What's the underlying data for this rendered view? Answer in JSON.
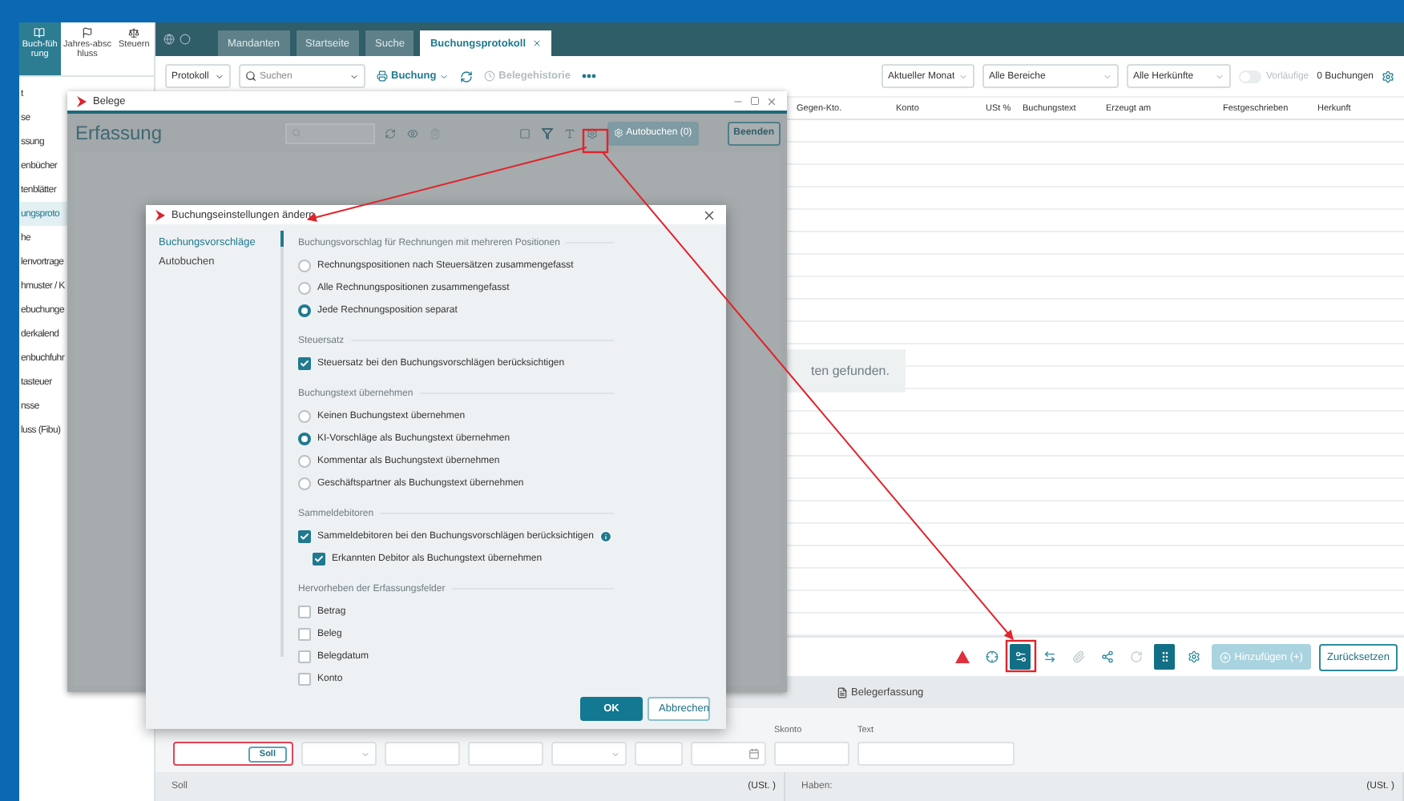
{
  "left_nav": {
    "top_items": [
      {
        "label": "Buch-führung",
        "selected": true
      },
      {
        "label": "Jahres-abschluss",
        "selected": false
      },
      {
        "label": "Steuern",
        "selected": false
      }
    ],
    "items": [
      {
        "label": "t",
        "selected": false
      },
      {
        "label": "se",
        "selected": false
      },
      {
        "label": "ssung",
        "selected": false
      },
      {
        "label": "enbücher",
        "selected": false
      },
      {
        "label": "tenblätter",
        "selected": false
      },
      {
        "label": "ungsproto",
        "selected": true
      },
      {
        "label": "he",
        "selected": false
      },
      {
        "label": "lenvortrage",
        "selected": false
      },
      {
        "label": "hmuster / K",
        "selected": false
      },
      {
        "label": "ebuchunge",
        "selected": false
      },
      {
        "label": "derkalend",
        "selected": false
      },
      {
        "label": "enbuchfuhr",
        "selected": false
      },
      {
        "label": "tasteuer",
        "selected": false
      },
      {
        "label": "nsse",
        "selected": false
      },
      {
        "label": "luss (Fibu)",
        "selected": false
      }
    ]
  },
  "tabs": [
    {
      "label": "Mandanten",
      "selected": false,
      "closable": false
    },
    {
      "label": "Startseite",
      "selected": false,
      "closable": false
    },
    {
      "label": "Suche",
      "selected": false,
      "closable": false
    },
    {
      "label": "Buchungsprotokoll",
      "selected": true,
      "closable": true
    }
  ],
  "toolbar": {
    "view": "Protokoll",
    "search_placeholder": "Suchen",
    "booking": "Buchung",
    "history": {
      "label": "Belegehistorie",
      "disabled": true
    },
    "filters": [
      "Aktueller Monat",
      "Alle Bereiche",
      "Alle Herkünfte"
    ],
    "toggle": {
      "label": "Vorläufige",
      "on": false,
      "disabled": true
    },
    "count": "0 Buchungen"
  },
  "table": {
    "columns": [
      "Gegen-Kto.",
      "Konto",
      "USt %",
      "Buchungstext",
      "Erzeugt am",
      "Festgeschrieben",
      "Herkunft"
    ],
    "empty_message": "ten gefunden."
  },
  "belege_window": {
    "title": "Belege",
    "heading": "Erfassung",
    "autobook": {
      "label": "Autobuchen (0)",
      "disabled": true
    },
    "close_button": "Beenden"
  },
  "dialog": {
    "title": "Buchungseinstellungen ändern",
    "nav": [
      {
        "label": "Buchungsvorschläge",
        "selected": true
      },
      {
        "label": "Autobuchen",
        "selected": false
      }
    ],
    "sections": [
      {
        "title": "Buchungsvorschlag für Rechnungen mit mehreren Positionen",
        "items": [
          {
            "kind": "radio",
            "label": "Rechnungspositionen nach Steuersätzen zusammengefasst",
            "selected": false
          },
          {
            "kind": "radio",
            "label": "Alle Rechnungspositionen zusammengefasst",
            "selected": false
          },
          {
            "kind": "radio",
            "label": "Jede Rechnungsposition separat",
            "selected": true
          }
        ]
      },
      {
        "title": "Steuersatz",
        "items": [
          {
            "kind": "checkbox",
            "label": "Steuersatz bei den Buchungsvorschlägen berücksichtigen",
            "checked": true
          }
        ]
      },
      {
        "title": "Buchungstext übernehmen",
        "items": [
          {
            "kind": "radio",
            "label": "Keinen Buchungstext übernehmen",
            "selected": false
          },
          {
            "kind": "radio",
            "label": "KI-Vorschläge als Buchungstext übernehmen",
            "selected": true
          },
          {
            "kind": "radio",
            "label": "Kommentar als Buchungstext übernehmen",
            "selected": false
          },
          {
            "kind": "radio",
            "label": "Geschäftspartner als Buchungstext übernehmen",
            "selected": false
          }
        ]
      },
      {
        "title": "Sammeldebitoren",
        "items": [
          {
            "kind": "checkbox",
            "label": "Sammeldebitoren bei den Buchungsvorschlägen berücksichtigen",
            "checked": true,
            "info": true,
            "children": [
              {
                "kind": "checkbox",
                "label": "Erkannten Debitor als Buchungstext übernehmen",
                "checked": true
              }
            ]
          }
        ]
      },
      {
        "title": "Hervorheben der Erfassungsfelder",
        "items": [
          {
            "kind": "checkbox",
            "label": "Betrag",
            "checked": false
          },
          {
            "kind": "checkbox",
            "label": "Beleg",
            "checked": false
          },
          {
            "kind": "checkbox",
            "label": "Belegdatum",
            "checked": false
          },
          {
            "kind": "checkbox",
            "label": "Konto",
            "checked": false
          }
        ]
      }
    ],
    "ok": "OK",
    "cancel": "Abbrechen"
  },
  "bottom_toolbar": {
    "icons": [
      {
        "kind": "warning",
        "selected": false
      },
      {
        "kind": "target",
        "selected": false
      },
      {
        "kind": "settings",
        "selected": true
      },
      {
        "kind": "swap",
        "selected": false
      },
      {
        "kind": "attach",
        "selected": false
      },
      {
        "kind": "share",
        "selected": false
      },
      {
        "kind": "reload",
        "selected": false
      },
      {
        "kind": "grip",
        "selected": true
      },
      {
        "kind": "gear",
        "selected": false
      }
    ],
    "add": {
      "label": "Hinzufügen (+)",
      "disabled": true
    },
    "reset": "Zurücksetzen"
  },
  "entry_tab": "Belegerfassung",
  "form_fields": [
    {
      "kind": "amount",
      "button": "Soll",
      "error": true
    },
    {
      "kind": "select"
    },
    {
      "kind": "text"
    },
    {
      "kind": "text"
    },
    {
      "kind": "select"
    },
    {
      "kind": "short"
    },
    {
      "kind": "date"
    },
    {
      "kind": "text",
      "label": "Skonto"
    },
    {
      "kind": "wide",
      "label": "Text"
    }
  ],
  "summary": {
    "left_label": "Soll",
    "left_tax": "(USt. )",
    "right_label": "Haben:",
    "right_tax": "(USt. )"
  }
}
